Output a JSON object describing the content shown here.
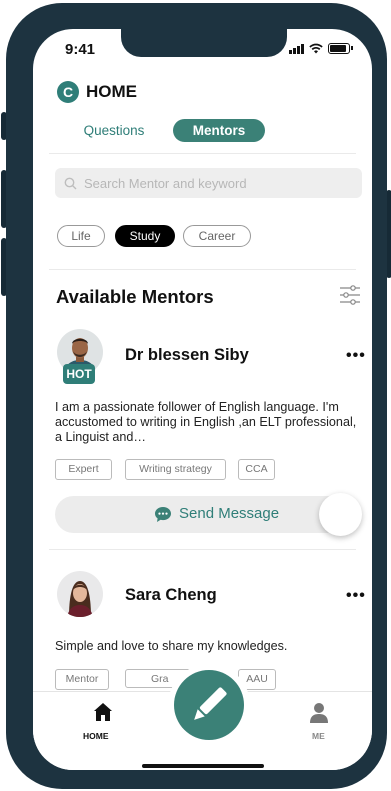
{
  "status_bar": {
    "time": "9:41"
  },
  "header": {
    "logo_letter": "C",
    "title": "HOME"
  },
  "segmented": {
    "questions": "Questions",
    "mentors": "Mentors"
  },
  "search": {
    "placeholder": "Search  Mentor and keyword"
  },
  "filters": [
    "Life",
    "Study",
    "Career"
  ],
  "section": {
    "title": "Available Mentors"
  },
  "mentors": [
    {
      "name": "Dr blessen Siby",
      "badge": "HOT",
      "bio": "I am a passionate follower of English language. I'm accustomed to writing in English ,an ELT professional, a Linguist and…",
      "tags": [
        "Expert",
        "Writing strategy",
        "CCA"
      ],
      "action": "Send Message"
    },
    {
      "name": "Sara Cheng",
      "bio": "Simple and love to share my knowledges.",
      "tags": [
        "Mentor",
        "Gra",
        "AAU"
      ]
    }
  ],
  "tabbar": {
    "home": "HOME",
    "me": "ME"
  },
  "colors": {
    "accent": "#3b8177",
    "frame": "#1d3340"
  },
  "icons": {
    "search": "search-icon",
    "filter": "sliders-icon",
    "more": "more-dots-icon",
    "chat": "chat-bubble-icon",
    "compose": "pencil-icon",
    "home": "home-icon",
    "profile": "person-icon"
  }
}
